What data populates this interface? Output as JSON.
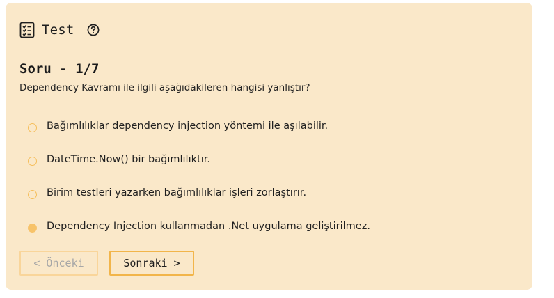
{
  "header": {
    "title": "Test",
    "title_icon": "checklist-icon",
    "help_icon": "question-circle-icon"
  },
  "question": {
    "number_label": "Soru - 1/7",
    "text": "Dependency Kavramı ile ilgili aşağıdakileren hangisi yanlıştır?"
  },
  "options": [
    {
      "label": "Bağımlılıklar dependency injection yöntemi ile aşılabilir.",
      "selected": false
    },
    {
      "label": "DateTime.Now() bir bağımlılıktır.",
      "selected": false
    },
    {
      "label": "Birim testleri yazarken bağımlılıklar işleri zorlaştırır.",
      "selected": false
    },
    {
      "label": "Dependency Injection kullanmadan .Net uygulama geliştirilmez.",
      "selected": true
    }
  ],
  "navigation": {
    "prev_label": "< Önceki",
    "prev_enabled": false,
    "next_label": "Sonraki >"
  },
  "colors": {
    "card_background": "#fae8c9",
    "accent": "#f7c36a",
    "accent_border": "#f2b54a"
  }
}
